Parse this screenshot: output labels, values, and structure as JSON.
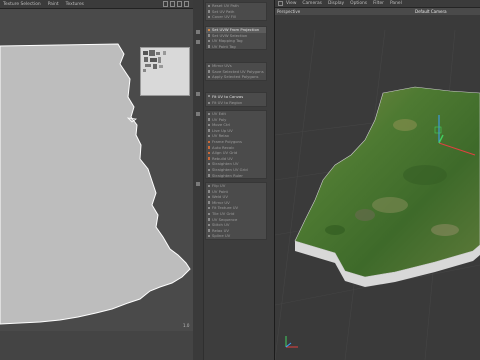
{
  "uv_editor": {
    "menus": [
      "Texture Selection",
      "Paint",
      "Textures"
    ],
    "scale_label": "1.0"
  },
  "commands": {
    "group1": [
      {
        "label": "Reset UV Path",
        "state": "normal"
      },
      {
        "label": "Set UV Path",
        "state": "normal"
      },
      {
        "label": "Cover UV Fill",
        "state": "normal"
      }
    ],
    "group2": [
      {
        "label": "Set UVW From Projection",
        "state": "highlight"
      },
      {
        "label": "Set UVW Selection",
        "state": "normal"
      },
      {
        "label": "UV Mapping Tag",
        "state": "normal"
      },
      {
        "label": "UV Point Tag",
        "state": "normal"
      }
    ],
    "group3": [
      {
        "label": "Mirror UVs",
        "state": "normal"
      },
      {
        "label": "Save Selected UV Polygons",
        "state": "normal"
      },
      {
        "label": "Apply Selected Polygons",
        "state": "normal"
      }
    ],
    "group4": [
      {
        "label": "Fit UV to Canvas",
        "state": "big"
      },
      {
        "label": "Fit UV to Region",
        "state": "normal"
      }
    ],
    "group5": [
      {
        "label": "UV Edit",
        "state": "normal"
      },
      {
        "label": "UV Poly",
        "state": "normal"
      },
      {
        "label": "Move Ctrl",
        "state": "normal"
      },
      {
        "label": "Live Up UV",
        "state": "normal"
      },
      {
        "label": "UV Relax",
        "state": "normal"
      },
      {
        "label": "Frame Polygons",
        "state": "orange"
      },
      {
        "label": "Auto Recalc",
        "state": "orange"
      },
      {
        "label": "Align UV Grid",
        "state": "orange"
      },
      {
        "label": "Rebuild UV",
        "state": "orange"
      },
      {
        "label": "Straighten UV",
        "state": "normal"
      },
      {
        "label": "Straighten UV Grid",
        "state": "normal"
      },
      {
        "label": "Straighten Ruler",
        "state": "normal"
      }
    ],
    "group6": [
      {
        "label": "Flip UV",
        "state": "normal"
      },
      {
        "label": "UV Paint",
        "state": "normal"
      },
      {
        "label": "Weld UV",
        "state": "normal"
      },
      {
        "label": "Mirror UV",
        "state": "normal"
      },
      {
        "label": "Fit Texture UV",
        "state": "normal"
      },
      {
        "label": "Tile UV Grid",
        "state": "normal"
      },
      {
        "label": "UV Sequence",
        "state": "normal"
      },
      {
        "label": "Stitch UV",
        "state": "normal"
      },
      {
        "label": "Relax UV",
        "state": "normal"
      },
      {
        "label": "Spline UV",
        "state": "normal"
      }
    ]
  },
  "viewport": {
    "menus": [
      "View",
      "Cameras",
      "Display",
      "Options",
      "Filter",
      "Panel"
    ],
    "title": "Perspective",
    "camera": "Default Camera"
  },
  "colors": {
    "uv_fill": "#bdbdbd",
    "uv_outline": "#ffffff",
    "terrain_green": "#4e7a32",
    "terrain_edge": "#d8d8d8",
    "accent_orange": "#d38a4a"
  }
}
